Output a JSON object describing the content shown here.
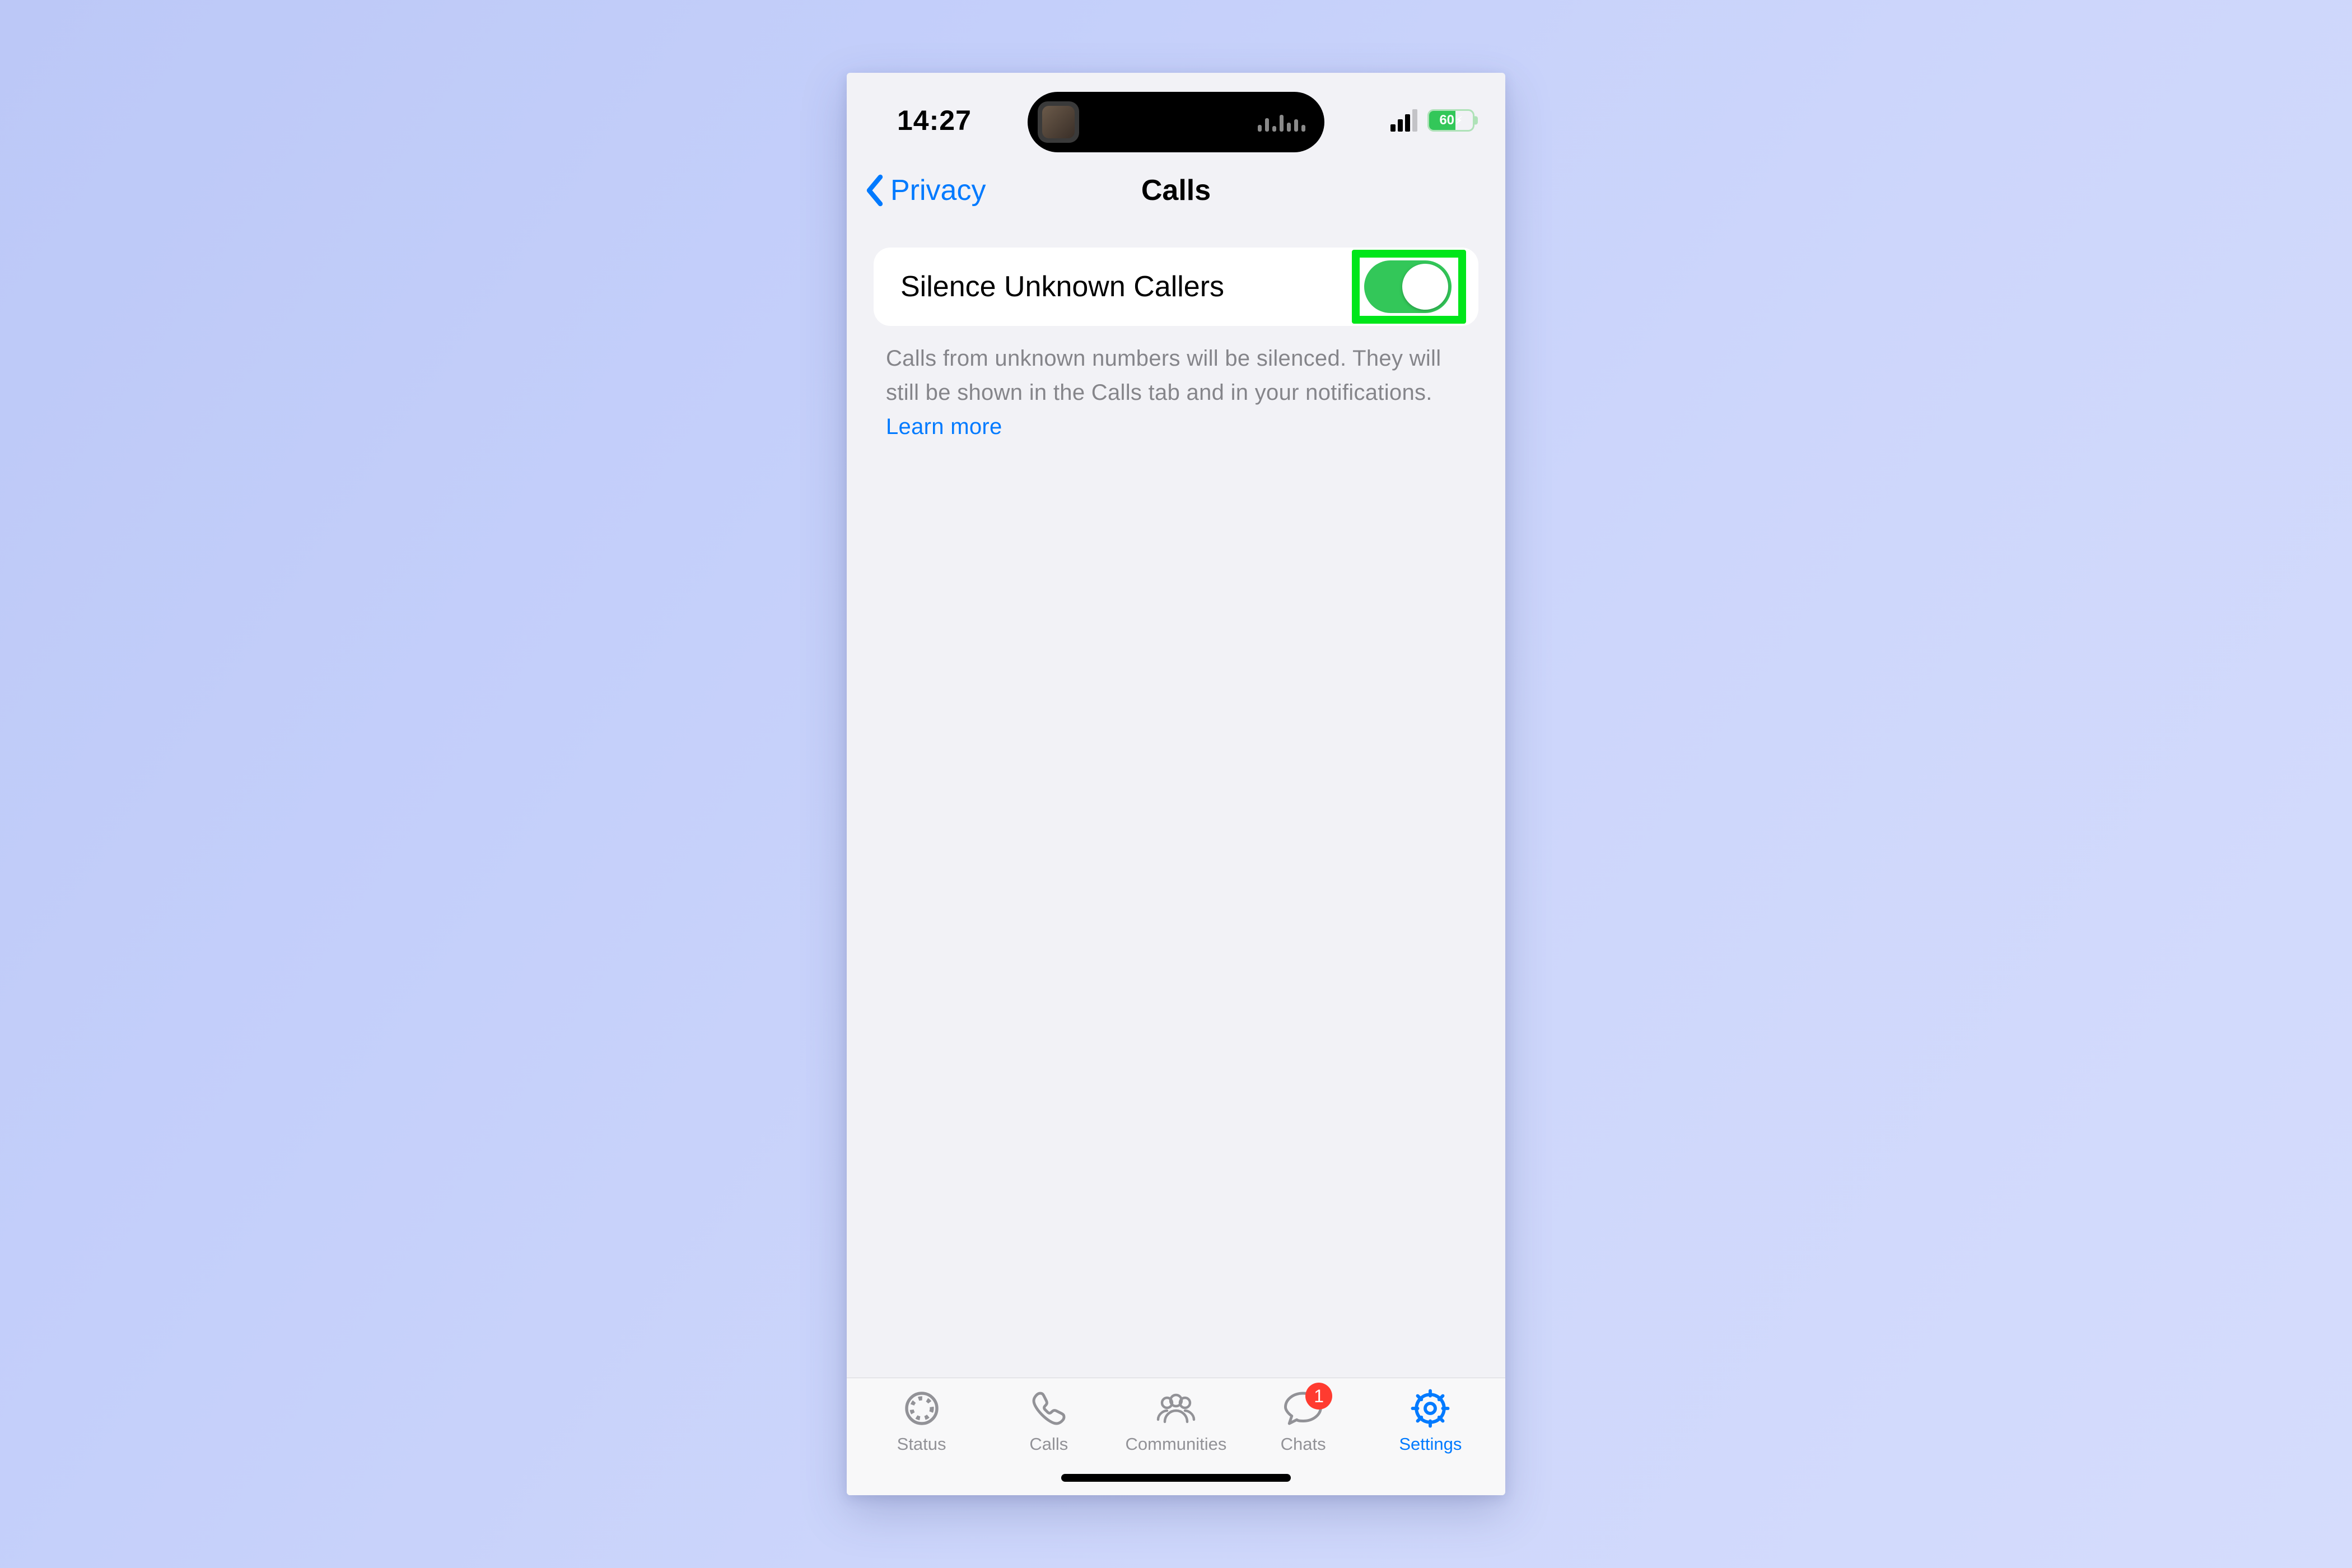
{
  "status": {
    "time": "14:27",
    "battery_pct": "60"
  },
  "nav": {
    "back_label": "Privacy",
    "title": "Calls"
  },
  "setting": {
    "label": "Silence Unknown Callers",
    "toggle_on": true
  },
  "footer": {
    "text": "Calls from unknown numbers will be silenced. They will still be shown in the Calls tab and in your notifications.",
    "learn_more": "Learn more"
  },
  "tabs": {
    "status": "Status",
    "calls": "Calls",
    "communities": "Communities",
    "chats": "Chats",
    "chats_badge": "1",
    "settings": "Settings"
  }
}
